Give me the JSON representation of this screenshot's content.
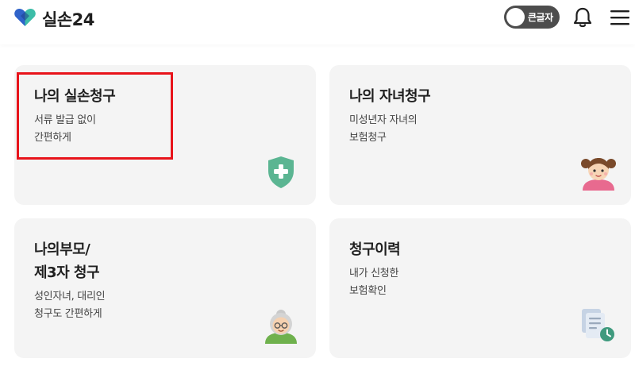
{
  "header": {
    "brand_title": "실손24",
    "large_text_toggle_label": "큰글자"
  },
  "cards": [
    {
      "title": "나의 실손청구",
      "subtitle_line1": "서류 발급 없이",
      "subtitle_line2": "간편하게",
      "icon": "shield-plus-icon"
    },
    {
      "title": "나의 자녀청구",
      "subtitle_line1": "미성년자 자녀의",
      "subtitle_line2": "보험청구",
      "icon": "child-girl-icon"
    },
    {
      "title_line1": "나의부모/",
      "title_line2": "제3자 청구",
      "subtitle_line1": "성인자녀, 대리인",
      "subtitle_line2": "청구도 간편하게",
      "icon": "grandmother-icon"
    },
    {
      "title": "청구이력",
      "subtitle_line1": "내가 신청한",
      "subtitle_line2": "보험확인",
      "icon": "document-clock-icon"
    }
  ],
  "colors": {
    "brand_blue": "#2f63c9",
    "brand_teal": "#3dbda8",
    "shield_green": "#5bb592",
    "highlight_red": "#e8141b",
    "card_bg": "#f4f4f4"
  }
}
